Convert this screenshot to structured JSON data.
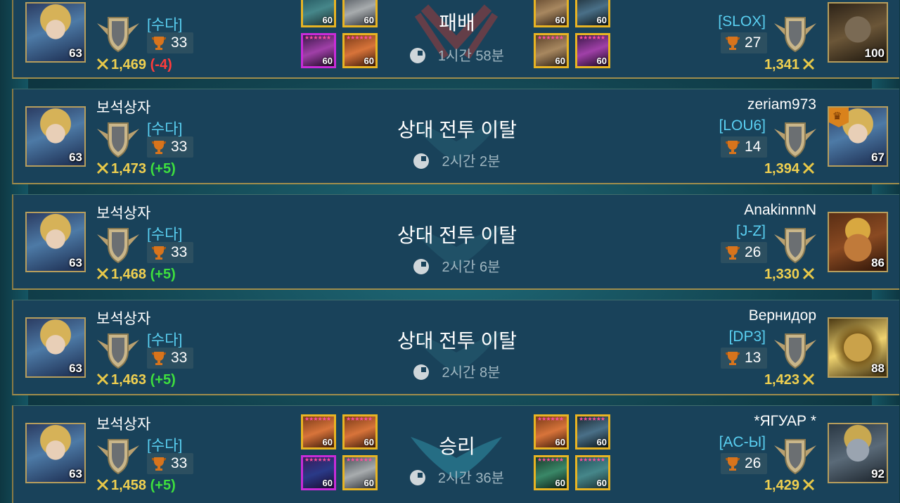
{
  "rows": [
    {
      "player": {
        "name": "",
        "clan": "[수다]",
        "trophies": "33",
        "level": "63",
        "rating": "1,469",
        "delta": "(-4)"
      },
      "result": "패배",
      "time": "1시간 58분",
      "my_heroes": [
        "60",
        "60",
        "60",
        "60"
      ],
      "opp_heroes": [
        "60",
        "60",
        "60",
        "60"
      ],
      "opponent": {
        "name": "",
        "clan": "[SLOX]",
        "trophies": "27",
        "level": "100",
        "rating": "1,341"
      }
    },
    {
      "player": {
        "name": "보석상자",
        "clan": "[수다]",
        "trophies": "33",
        "level": "63",
        "rating": "1,473",
        "delta": "(+5)"
      },
      "result": "상대 전투 이탈",
      "time": "2시간 2분",
      "opponent": {
        "name": "zeriam973",
        "clan": "[LOU6]",
        "trophies": "14",
        "level": "67",
        "rating": "1,394"
      }
    },
    {
      "player": {
        "name": "보석상자",
        "clan": "[수다]",
        "trophies": "33",
        "level": "63",
        "rating": "1,468",
        "delta": "(+5)"
      },
      "result": "상대 전투 이탈",
      "time": "2시간 6분",
      "opponent": {
        "name": "AnakinnnN",
        "clan": "[J-Z]",
        "trophies": "26",
        "level": "86",
        "rating": "1,330"
      }
    },
    {
      "player": {
        "name": "보석상자",
        "clan": "[수다]",
        "trophies": "33",
        "level": "63",
        "rating": "1,463",
        "delta": "(+5)"
      },
      "result": "상대 전투 이탈",
      "time": "2시간 8분",
      "opponent": {
        "name": "Вернидор",
        "clan": "[DP3]",
        "trophies": "13",
        "level": "88",
        "rating": "1,423"
      }
    },
    {
      "player": {
        "name": "보석상자",
        "clan": "[수다]",
        "trophies": "33",
        "level": "63",
        "rating": "1,458",
        "delta": "(+5)"
      },
      "result": "승리",
      "time": "2시간 36분",
      "my_heroes": [
        "60",
        "60",
        "60",
        "60"
      ],
      "opp_heroes": [
        "60",
        "60",
        "60",
        "60"
      ],
      "opponent": {
        "name": "*ЯГУАР *",
        "clan": "[AC-Ы]",
        "trophies": "26",
        "level": "92",
        "rating": "1,429"
      }
    }
  ],
  "colors": {
    "win_delta": "#3ee03e",
    "loss_delta": "#ff3b3b",
    "rating": "#f0d050",
    "clan": "#5ad0f2"
  },
  "icons": {
    "shield": "winged-shield-icon",
    "trophy": "trophy-icon",
    "rating": "crossed-swords-icon",
    "time": "clock-icon",
    "leader": "crown-icon"
  }
}
